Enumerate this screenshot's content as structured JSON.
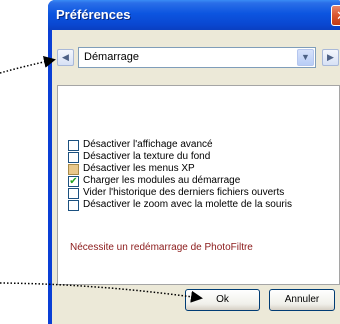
{
  "window": {
    "title": "Préférences",
    "close_glyph": "✕"
  },
  "nav": {
    "prev_icon": "arrow-left-icon",
    "next_icon": "arrow-right-icon",
    "prev_glyph": "◀",
    "next_glyph": "▶"
  },
  "category_select": {
    "value": "Démarrage",
    "arrow_glyph": "▼"
  },
  "options": [
    {
      "label": "Désactiver l'affichage avancé",
      "state": "unchecked"
    },
    {
      "label": "Désactiver la texture du fond",
      "state": "unchecked"
    },
    {
      "label": "Désactiver les menus XP",
      "state": "indeterminate"
    },
    {
      "label": "Charger les modules au démarrage",
      "state": "checked"
    },
    {
      "label": "Vider l'historique des derniers fichiers ouverts",
      "state": "unchecked"
    },
    {
      "label": "Désactiver le zoom avec la molette de la souris",
      "state": "unchecked"
    }
  ],
  "check_glyph": "✔",
  "note": "Nécessite un redémarrage de PhotoFiltre",
  "buttons": {
    "ok": "Ok",
    "cancel": "Annuler"
  },
  "colors": {
    "titlebar": "#0c55e0",
    "note_text": "#8b1a1a",
    "checkmark": "#21a121",
    "annotation": "#000000"
  }
}
